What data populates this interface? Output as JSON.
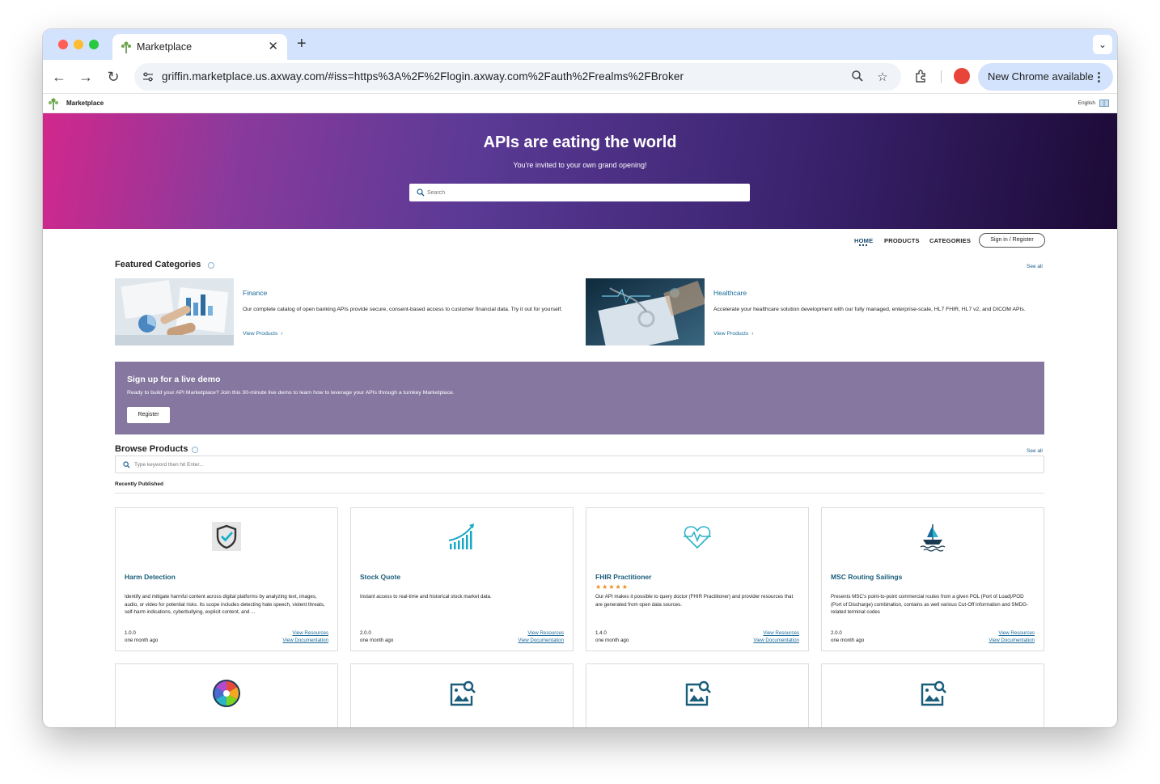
{
  "browser": {
    "tab_title": "Marketplace",
    "url": "griffin.marketplace.us.axway.com/#iss=https%3A%2F%2Flogin.axway.com%2Fauth%2Frealms%2FBroker",
    "update_label": "New Chrome available"
  },
  "app": {
    "name": "Marketplace",
    "language": "English"
  },
  "hero": {
    "title": "APIs are eating the world",
    "subtitle": "You're invited to your own grand opening!",
    "search_placeholder": "Search"
  },
  "nav": {
    "home": "HOME",
    "products": "PRODUCTS",
    "categories": "CATEGORIES",
    "signin": "Sign in / Register"
  },
  "featured": {
    "title": "Featured Categories",
    "see_all": "See all",
    "items": [
      {
        "title": "Finance",
        "description": "Our complete catalog of open banking APIs provide secure, consent-based access to customer financial data. Try it out for yourself.",
        "link": "View Products"
      },
      {
        "title": "Healthcare",
        "description": "Accelerate your healthcare solution development with our fully managed, enterprise-scale, HL7 FHIR, HL7 v2, and DICOM APIs.",
        "link": "View Products"
      }
    ]
  },
  "demo": {
    "title": "Sign up for a live demo",
    "text": "Ready to build your API Marketplace? Join this 30-minute live demo to learn how to leverage your APIs through a turnkey Marketplace.",
    "button": "Register"
  },
  "browse": {
    "title": "Browse Products",
    "see_all": "See all",
    "search_placeholder": "Type keyword then hit Enter...",
    "recent_label": "Recently Published"
  },
  "products": [
    {
      "title": "Harm Detection",
      "icon": "shield-check-icon",
      "description": " Identify and mitigate harmful content across digital platforms by analyzing text, images, audio, or video for potential risks. Its scope includes detecting hate speech, violent threats, self-harm indications, cyberbullying, explicit content, and ...",
      "version": "1.0.0",
      "updated": "one month ago",
      "resources": "View Resources",
      "documentation": "View Documentation"
    },
    {
      "title": "Stock Quote",
      "icon": "chart-growth-icon",
      "description": "Instant access to real-time and historical stock market data.",
      "version": "2.0.0",
      "updated": "one month ago",
      "resources": "View Resources",
      "documentation": "View Documentation"
    },
    {
      "title": "FHIR Practitioner",
      "icon": "heartbeat-icon",
      "stars": "★★★★★",
      "rating": 5,
      "description": "Our API makes it possible to query doctor (FHIR Practitioner) and provider resources that are generated from open data sources.",
      "version": "1.4.0",
      "updated": "one month ago",
      "resources": "View Resources",
      "documentation": "View Documentation"
    },
    {
      "title": "MSC Routing Sailings",
      "icon": "ship-icon",
      "description": "Presents MSC's point-to-point commercial routes from a given POL (Port of Load)/POD (Port of Discharge) combination, contains as well various Cut-Off information and SMDG-related terminal codes",
      "version": "2.0.0",
      "updated": "one month ago",
      "resources": "View Resources",
      "documentation": "View Documentation"
    }
  ],
  "products_row2_icons": [
    "color-wheel-icon",
    "image-search-icon",
    "image-search-icon",
    "image-search-icon"
  ],
  "colors": {
    "accent": "#1a6a9a",
    "demo_banner": "#85779f",
    "hero_start": "#d2278c",
    "hero_end": "#1c0a36"
  }
}
